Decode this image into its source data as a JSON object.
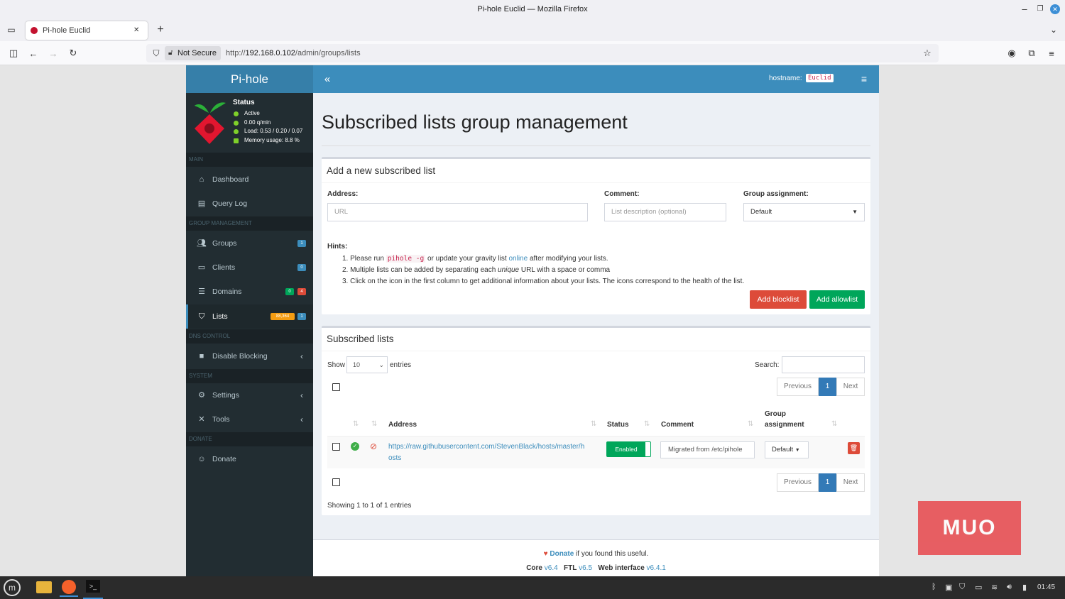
{
  "window": {
    "title": "Pi-hole Euclid — Mozilla Firefox",
    "tab_title": "Pi-hole Euclid",
    "not_secure": "Not Secure",
    "url_prefix": "http://",
    "url_host": "192.168.0.102",
    "url_path": "/admin/groups/lists"
  },
  "sidebar": {
    "logo": "Pi-hole",
    "status": {
      "title": "Status",
      "active": "Active",
      "qpm": "0.00 q/min",
      "load": "Load: 0.53 / 0.20 / 0.07",
      "memory": "Memory usage: 8.8 %"
    },
    "sections": {
      "main": "MAIN",
      "group": "GROUP MANAGEMENT",
      "dns": "DNS CONTROL",
      "system": "SYSTEM",
      "donate": "DONATE"
    },
    "items": {
      "dashboard": "Dashboard",
      "querylog": "Query Log",
      "groups": "Groups",
      "clients": "Clients",
      "domains": "Domains",
      "lists": "Lists",
      "disable": "Disable Blocking",
      "settings": "Settings",
      "tools": "Tools",
      "donate": "Donate"
    },
    "badges": {
      "groups": "1",
      "clients": "0",
      "domains_allow": "0",
      "domains_deny": "4",
      "lists_count": "88,364",
      "lists_num": "1"
    }
  },
  "topnav": {
    "hostname_label": "hostname:",
    "hostname": "Euclid"
  },
  "main": {
    "page_title": "Subscribed lists group management",
    "add": {
      "title": "Add a new subscribed list",
      "address_label": "Address:",
      "address_placeholder": "URL",
      "comment_label": "Comment:",
      "comment_placeholder": "List description (optional)",
      "group_label": "Group assignment:",
      "group_value": "Default",
      "hints_label": "Hints:",
      "hint1_a": "Please run",
      "hint1_code": "pihole -g",
      "hint1_b": "or update your gravity list",
      "hint1_link": "online",
      "hint1_c": "after modifying your lists.",
      "hint2_a": "Multiple lists can be added by separating each",
      "hint2_em": "unique",
      "hint2_b": "URL with a space or comma",
      "hint3": "Click on the icon in the first column to get additional information about your lists. The icons correspond to the health of the list.",
      "btn_block": "Add blocklist",
      "btn_allow": "Add allowlist"
    },
    "list": {
      "title": "Subscribed lists",
      "show": "Show",
      "entries_value": "10",
      "entries": "entries",
      "search": "Search:",
      "prev": "Previous",
      "page": "1",
      "next": "Next",
      "headers": {
        "address": "Address",
        "status": "Status",
        "comment": "Comment",
        "group1": "Group",
        "group2": "assignment"
      },
      "row": {
        "address_line1": "https://raw.githubusercontent.com/StevenBlack/hosts/master/h",
        "address_line2": "osts",
        "status": "Enabled",
        "comment": "Migrated from /etc/pihole",
        "group": "Default"
      },
      "showing": "Showing 1 to 1 of 1 entries"
    },
    "footer": {
      "donate": "Donate",
      "donate_rest": "if you found this useful.",
      "core": "Core",
      "core_v": "v6.4",
      "ftl": "FTL",
      "ftl_v": "v6.5",
      "web": "Web interface",
      "web_v": "v6.4.1"
    }
  },
  "taskbar": {
    "time": "01:45"
  },
  "watermark": "MUO"
}
